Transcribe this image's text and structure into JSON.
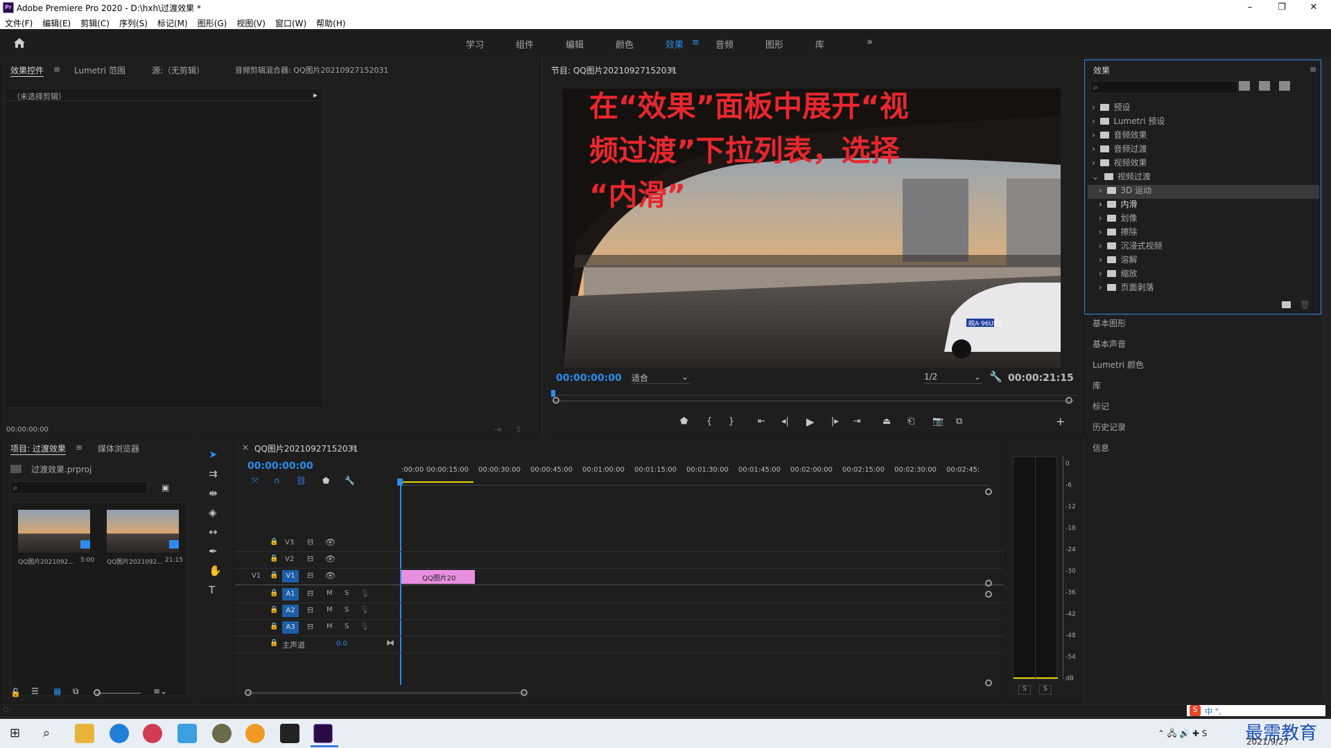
{
  "window": {
    "title": "Adobe Premiere Pro 2020 - D:\\hxh\\过渡效果 *",
    "app_icon": "Pr",
    "min": "–",
    "max": "❐",
    "close": "✕"
  },
  "menu": [
    "文件(F)",
    "编辑(E)",
    "剪辑(C)",
    "序列(S)",
    "标记(M)",
    "图形(G)",
    "视图(V)",
    "窗口(W)",
    "帮助(H)"
  ],
  "workspaces": {
    "tabs": [
      "学习",
      "组件",
      "编辑",
      "颜色",
      "效果",
      "音频",
      "图形",
      "库"
    ],
    "active": "效果",
    "more": "»"
  },
  "effect_controls": {
    "tabs": [
      "效果控件",
      "Lumetri 范围",
      "源:（无剪辑）",
      "音频剪辑混合器: QQ图片20210927152031"
    ],
    "no_clip": "（未选择剪辑）",
    "timecode": "00:00:00:00"
  },
  "program": {
    "title": "节目: QQ图片20210927152031",
    "overlay_lines": [
      "在“效果”面板中展开“视",
      "频过渡”下拉列表，选择",
      "“内滑”"
    ],
    "plate": "皖A·96US3",
    "timecode": "00:00:00:00",
    "fit": "适合",
    "resolution": "1/2",
    "duration": "00:00:21:15"
  },
  "effects_panel": {
    "title": "效果",
    "items": [
      {
        "label": "预设",
        "level": 0
      },
      {
        "label": "Lumetri 预设",
        "level": 0
      },
      {
        "label": "音频效果",
        "level": 0
      },
      {
        "label": "音频过渡",
        "level": 0
      },
      {
        "label": "视频效果",
        "level": 0
      },
      {
        "label": "视频过渡",
        "level": 0,
        "expanded": true
      },
      {
        "label": "3D 运动",
        "level": 1
      },
      {
        "label": "内滑",
        "level": 1,
        "selected": true
      },
      {
        "label": "划像",
        "level": 1
      },
      {
        "label": "擦除",
        "level": 1
      },
      {
        "label": "沉浸式视频",
        "level": 1
      },
      {
        "label": "溶解",
        "level": 1
      },
      {
        "label": "缩放",
        "level": 1
      },
      {
        "label": "页面剥落",
        "level": 1
      }
    ]
  },
  "side_panels": [
    "基本图形",
    "基本声音",
    "Lumetri 颜色",
    "库",
    "标记",
    "历史记录",
    "信息"
  ],
  "project": {
    "tabs": [
      "项目: 过渡效果",
      "媒体浏览器"
    ],
    "file": "过渡效果.prproj",
    "clips": [
      {
        "name": "QQ图片2021092...",
        "dur": "5:00"
      },
      {
        "name": "QQ图片2021092...",
        "dur": "21:15"
      }
    ]
  },
  "timeline": {
    "seq_tab": "QQ图片20210927152031",
    "timecode": "00:00:00:00",
    "ruler": [
      ":00:00",
      "00:00:15:00",
      "00:00:30:00",
      "00:00:45:00",
      "00:01:00:00",
      "00:01:15:00",
      "00:01:30:00",
      "00:01:45:00",
      "00:02:00:00",
      "00:02:15:00",
      "00:02:30:00",
      "00:02:45:"
    ],
    "video_tracks": [
      "V3",
      "V2",
      "V1"
    ],
    "audio_tracks": [
      "A1",
      "A2",
      "A3"
    ],
    "source_patch": "V1",
    "master": "主声道",
    "master_val": "0.0",
    "clip_label": "QQ图片20",
    "mute": "M",
    "solo": "S"
  },
  "meter": {
    "scale": [
      "0",
      "-6",
      "-12",
      "-18",
      "-24",
      "-30",
      "-36",
      "-42",
      "-48",
      "-54",
      "dB"
    ],
    "s1": "S",
    "s2": "S"
  },
  "ime_bar": "中 °,",
  "watermark": "最需教育",
  "clock": "2021/9/27",
  "taskbar_apps": [
    "windows",
    "search",
    "explorer",
    "edge",
    "app-a",
    "app-b",
    "app-c",
    "app-d",
    "photos",
    "premiere"
  ]
}
